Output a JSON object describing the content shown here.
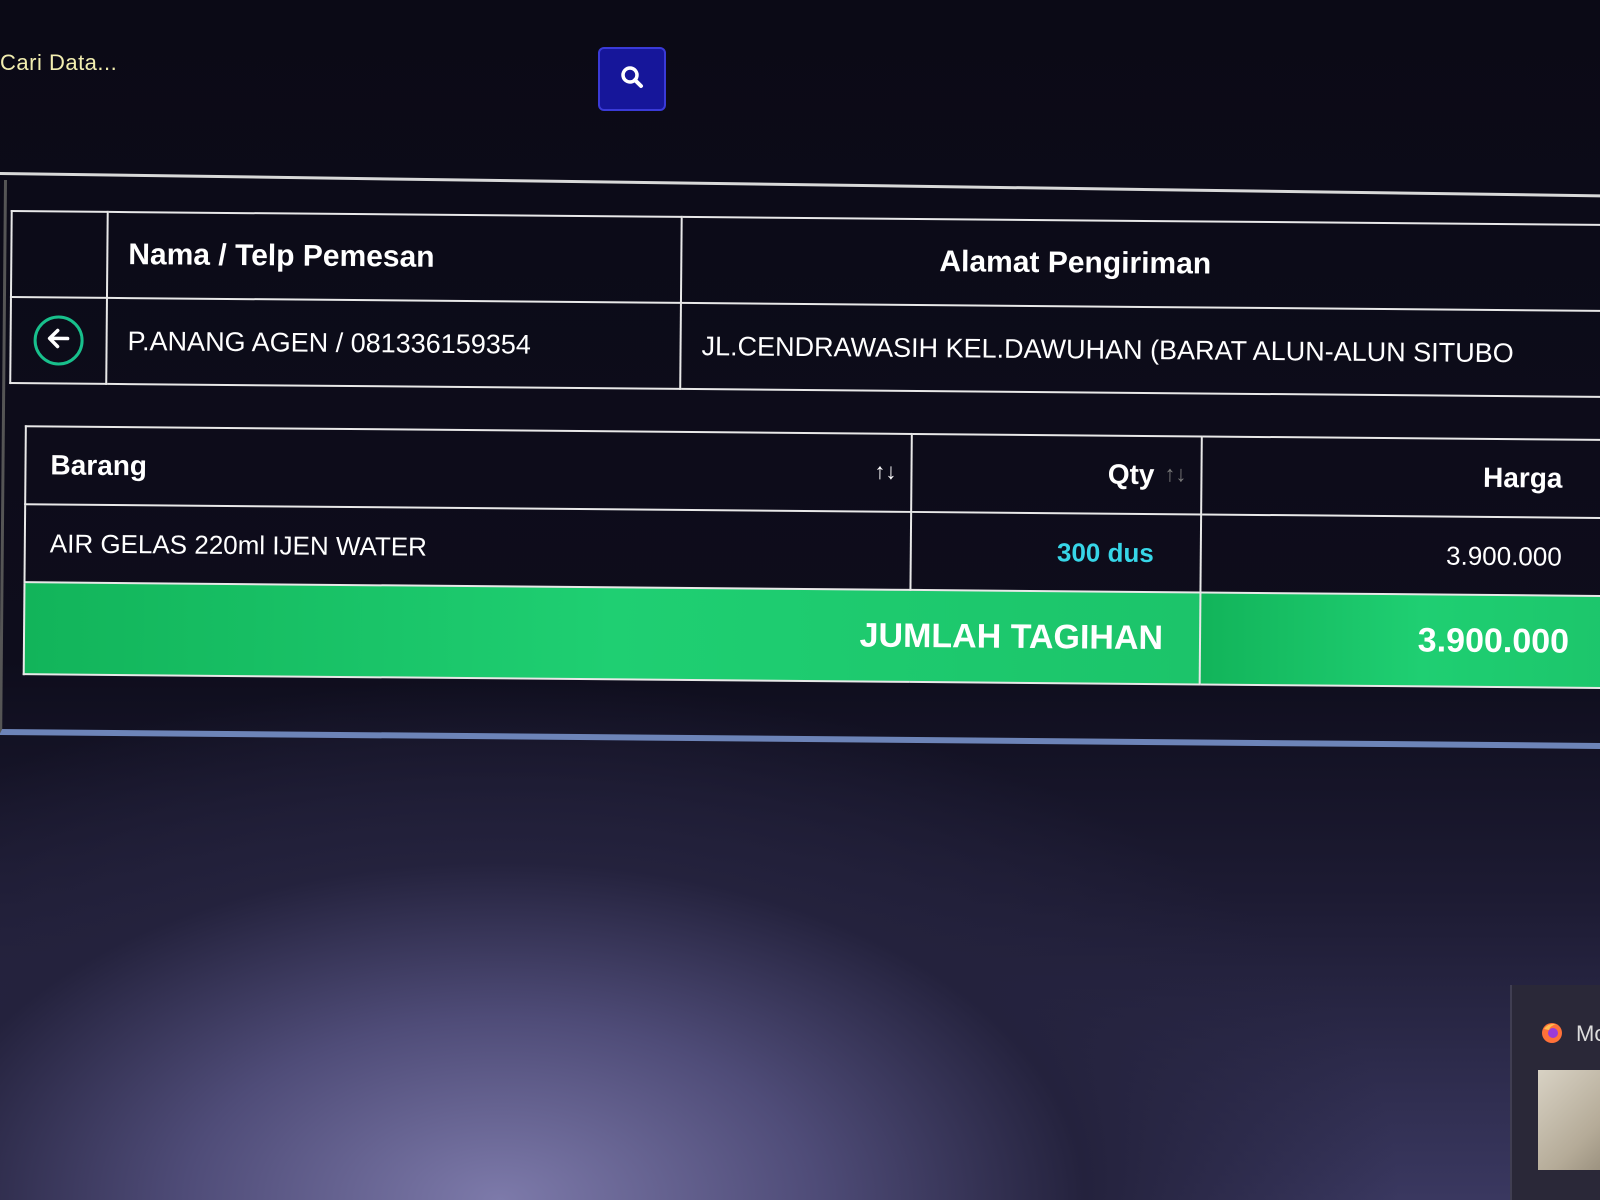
{
  "search": {
    "label": "Cari Data...",
    "button_icon": "search-icon"
  },
  "order": {
    "headers": {
      "name_phone": "Nama / Telp Pemesan",
      "address": "Alamat Pengiriman"
    },
    "row": {
      "back_icon": "arrow-left-icon",
      "name_phone": "P.ANANG AGEN / 081336159354",
      "address": "JL.CENDRAWASIH KEL.DAWUHAN (BARAT ALUN-ALUN SITUBO"
    }
  },
  "items": {
    "headers": {
      "barang": "Barang",
      "qty": "Qty",
      "harga": "Harga"
    },
    "sort_icon": "↑↓",
    "rows": [
      {
        "barang": "AIR GELAS 220ml IJEN WATER",
        "qty": "300 dus",
        "harga": "3.900.000"
      }
    ],
    "total": {
      "label": "JUMLAH TAGIHAN",
      "value": "3.900.000"
    }
  },
  "taskbar_preview": {
    "title": "Mo",
    "icon": "firefox-icon"
  },
  "colors": {
    "search_button": "#16169a",
    "accent_green": "#1fcf72",
    "qty_text": "#37d6e8",
    "search_label": "#f2eeb0"
  }
}
